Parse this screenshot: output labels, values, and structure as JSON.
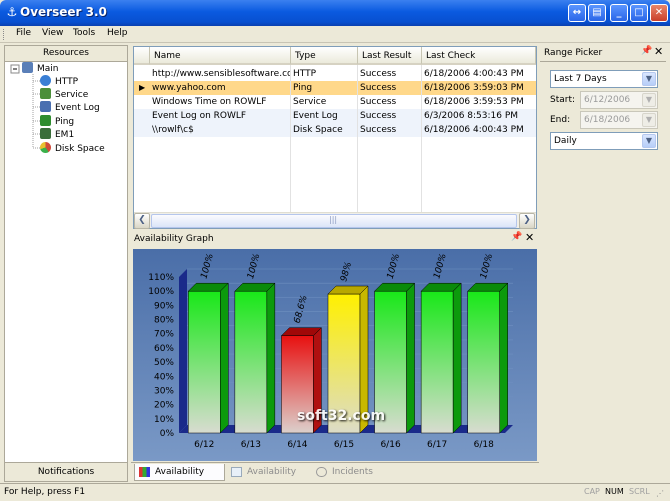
{
  "window": {
    "title": "Overseer 3.0",
    "icon": "anchor-icon"
  },
  "menu": [
    "File",
    "View",
    "Tools",
    "Help"
  ],
  "resources": {
    "header": "Resources",
    "tree": [
      {
        "label": "Main",
        "icon": "network-icon",
        "color": "#5a7fb8"
      },
      {
        "label": "HTTP",
        "icon": "globe-icon",
        "color": "#3a7fd5"
      },
      {
        "label": "Service",
        "icon": "service-icon",
        "color": "#4b8f3a"
      },
      {
        "label": "Event Log",
        "icon": "event-log-icon",
        "color": "#4a6fb0"
      },
      {
        "label": "Ping",
        "icon": "ping-icon",
        "color": "#2f8d2f"
      },
      {
        "label": "EM1",
        "icon": "em-icon",
        "color": "#3a6e3a"
      },
      {
        "label": "Disk Space",
        "icon": "disk-space-icon",
        "color": "#d04a3a"
      }
    ],
    "footer": "Notifications"
  },
  "grid": {
    "columns": [
      "Name",
      "Type",
      "Last Result",
      "Last Check"
    ],
    "rows": [
      [
        "http://www.sensiblesoftware.co...",
        "HTTP",
        "Success",
        "6/18/2006 4:00:43 PM"
      ],
      [
        "www.yahoo.com",
        "Ping",
        "Success",
        "6/18/2006 3:59:03 PM"
      ],
      [
        "Windows Time on ROWLF",
        "Service",
        "Success",
        "6/18/2006 3:59:53 PM"
      ],
      [
        "Event Log on ROWLF",
        "Event Log",
        "Success",
        "6/3/2006 8:53:16 PM"
      ],
      [
        "\\\\rowlf\\c$",
        "Disk Space",
        "Success",
        "6/18/2006 4:00:43 PM"
      ]
    ],
    "selected_row": 1
  },
  "graph_panel": {
    "title": "Availability Graph"
  },
  "chart_data": {
    "type": "bar",
    "categories": [
      "6/12",
      "6/13",
      "6/14",
      "6/15",
      "6/16",
      "6/17",
      "6/18"
    ],
    "values": [
      100,
      100,
      68.6,
      98,
      100,
      100,
      100
    ],
    "value_labels": [
      "100%",
      "100%",
      "68.6%",
      "98%",
      "100%",
      "100%",
      "100%"
    ],
    "y_ticks": [
      "0%",
      "10%",
      "20%",
      "30%",
      "40%",
      "50%",
      "60%",
      "70%",
      "80%",
      "90%",
      "100%",
      "110%"
    ],
    "ylim": [
      0,
      110
    ],
    "bar_colors": [
      "#18e018",
      "#18e018",
      "#e01010",
      "#f4f000",
      "#18e018",
      "#18e018",
      "#18e018"
    ],
    "background": "#5a7fb0",
    "grid": true
  },
  "tabs": [
    "Availability Graph",
    "Availability Grid",
    "Incidents"
  ],
  "range_picker": {
    "title": "Range Picker",
    "range": "Last 7 Days",
    "start_label": "Start:",
    "start": "6/12/2006",
    "end_label": "End:",
    "end": "6/18/2006",
    "granularity": "Daily"
  },
  "status": {
    "text": "For Help, press F1",
    "indicators": [
      "CAP",
      "NUM",
      "SCRL"
    ]
  },
  "watermark": "soft32.com"
}
